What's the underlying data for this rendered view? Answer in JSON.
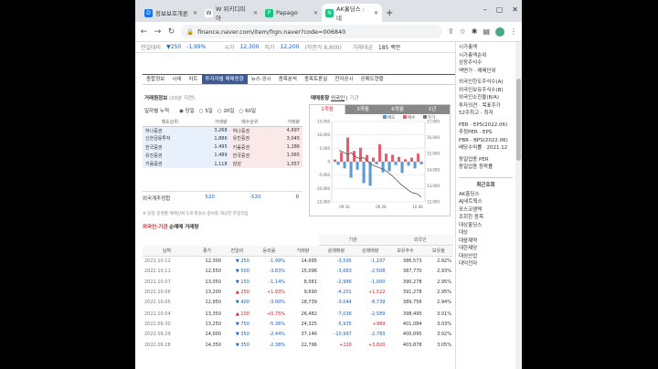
{
  "browser": {
    "tabs": [
      {
        "label": "정보보호개론",
        "fav": "#1a73e8",
        "active": false
      },
      {
        "label": "W 위키디피아",
        "fav": "#555",
        "active": false
      },
      {
        "label": "Papago",
        "fav": "#19c37d",
        "active": false
      },
      {
        "label": "AK홀딩스 : 네",
        "fav": "#19c37d",
        "active": true
      }
    ],
    "url": "finance.naver.com/item/frgn.naver?code=006840"
  },
  "price": {
    "label": "전일대비",
    "value": "▼250",
    "change": "-1.99%",
    "open_label": "시가",
    "open": "12,300",
    "low_label": "저가",
    "low": "12,200",
    "low_note": "(하한가 8,800)",
    "amount_label": "거래대금",
    "amount": "185 백만"
  },
  "menu": [
    "종합정보",
    "시세",
    "차트",
    "투자자별 매매동향",
    "뉴스·공시",
    "종목분석",
    "종목토론실",
    "전자공시",
    "공매도현황"
  ],
  "broker": {
    "title": "거래원정보",
    "sub": "(20분 지연)",
    "period_label": "일자별 누적",
    "periods": [
      "당일",
      "5일",
      "20일",
      "60일"
    ],
    "headers": [
      "매도상위",
      "거래량",
      "매수상위",
      "거래량"
    ],
    "rows": [
      [
        "하나증권",
        "3,268",
        "하나증권",
        "4,697"
      ],
      [
        "신한금융투자",
        "1,886",
        "유진증권",
        "3,045"
      ],
      [
        "한국증권",
        "1,495",
        "키움증권",
        "1,286"
      ],
      [
        "유진증권",
        "1,489",
        "한국증권",
        "1,065"
      ],
      [
        "키움증권",
        "1,118",
        "삼성",
        "1,057"
      ]
    ],
    "foreign_label": "외국계추정합",
    "foreign_sell": "520",
    "foreign_sell2": "-520",
    "foreign_buy": "0",
    "note": "※ 당일 증권별 매매상위 5개 회원사 정보를 제공한 추정치임"
  },
  "trend": {
    "title": "매매동향",
    "tab_on": "외국인",
    "tab_off": "기관",
    "periods": [
      "1개월",
      "3개월",
      "6개월",
      "1년"
    ],
    "legend": [
      "매도",
      "매수",
      "주가"
    ]
  },
  "chart_data": {
    "type": "bar",
    "x_ticks": [
      "09.16",
      "09.26",
      "10.06"
    ],
    "y_left": [
      "15,000",
      "10,000",
      "5,000",
      "0",
      "-5,000",
      "-10,000",
      "-15,000"
    ],
    "y_right": [
      "17,000",
      "16,000",
      "15,000",
      "14,000",
      "13,000",
      "12,000"
    ],
    "values": [
      800,
      -1200,
      3500,
      -2500,
      9000,
      -6000,
      4000,
      -3000,
      5200,
      -8000,
      2500,
      -9000,
      1500,
      -1000,
      6500,
      -4000,
      3000,
      -3600,
      2600,
      -1300,
      1800,
      -4200,
      900,
      -1500,
      1500,
      -2500,
      3000,
      -1000
    ],
    "price": [
      15200,
      15100,
      14950,
      15050,
      14800,
      14700,
      14750,
      14500,
      14300,
      14200,
      14100,
      14000,
      13800,
      13600,
      13350,
      13100,
      12900,
      12700,
      12550,
      12500,
      12300
    ]
  },
  "trades": {
    "title_a": "외국인",
    "title_b": "·기관",
    "title_c": "순매매 거래량",
    "headers": [
      "날짜",
      "종가",
      "전일비",
      "등락률",
      "거래량",
      "순매매량",
      "순매매량",
      "보유주수",
      "보유율"
    ],
    "group_inst": "기관",
    "group_foreign": "외국인",
    "rows": [
      [
        "2022.10.12",
        "12,300",
        "▼ 250",
        "-1.99%",
        "14,995",
        "-3,595",
        "-1,197",
        "386,573",
        "2.92%",
        "b"
      ],
      [
        "2022.10.11",
        "12,550",
        "▼ 500",
        "-3.83%",
        "15,096",
        "-3,683",
        "-2,508",
        "387,770",
        "2.93%",
        "b"
      ],
      [
        "2022.10.07",
        "13,050",
        "▼ 150",
        "-1.14%",
        "8,081",
        "-2,986",
        "-1,000",
        "390,278",
        "2.95%",
        "b"
      ],
      [
        "2022.10.06",
        "13,200",
        "▲ 250",
        "+1.93%",
        "9,690",
        "-4,201",
        "+1,522",
        "391,278",
        "2.95%",
        "r"
      ],
      [
        "2022.10.05",
        "12,950",
        "▼ 400",
        "-3.00%",
        "18,739",
        "-3,044",
        "-8,739",
        "389,756",
        "2.94%",
        "b"
      ],
      [
        "2022.10.04",
        "13,350",
        "▲ 100",
        "+0.75%",
        "26,482",
        "-7,036",
        "-2,589",
        "398,495",
        "3.01%",
        "r"
      ],
      [
        "2022.09.30",
        "13,250",
        "▼ 750",
        "-5.36%",
        "24,325",
        "-5,935",
        "+989",
        "401,084",
        "3.03%",
        "b"
      ],
      [
        "2022.09.29",
        "14,000",
        "▼ 350",
        "-2.44%",
        "37,146",
        "-10,997",
        "-2,783",
        "400,095",
        "3.02%",
        "b"
      ],
      [
        "2022.09.28",
        "14,350",
        "▼ 350",
        "-2.38%",
        "22,796",
        "+220",
        "+3,820",
        "403,878",
        "3.05%",
        "b"
      ]
    ]
  },
  "side": {
    "items": [
      "시가총액",
      "시가총액순위",
      "상장주식수",
      "액면가 · 매매단위",
      "외국인한도주식수(A)",
      "외국인보유주식수(B)",
      "외국인소진율(B/A)",
      "투자의견 · 목표주가",
      "52주최고 · 최저",
      "PER · EPS(2022.06)",
      "추정PER · EPS",
      "PBR · BPS(2022.06)",
      "배당수익률 · 2021.12",
      "동일업종 PER",
      "동일업종 등락률"
    ],
    "recent_title": "최근조회",
    "recent": [
      "AK홀딩스",
      "AJ네트웍스",
      "포스코엠텍",
      "조회한 종목",
      "대상홀딩스",
      "대상",
      "대웅제약",
      "대한제당",
      "대성산업",
      "대덕전자"
    ]
  }
}
